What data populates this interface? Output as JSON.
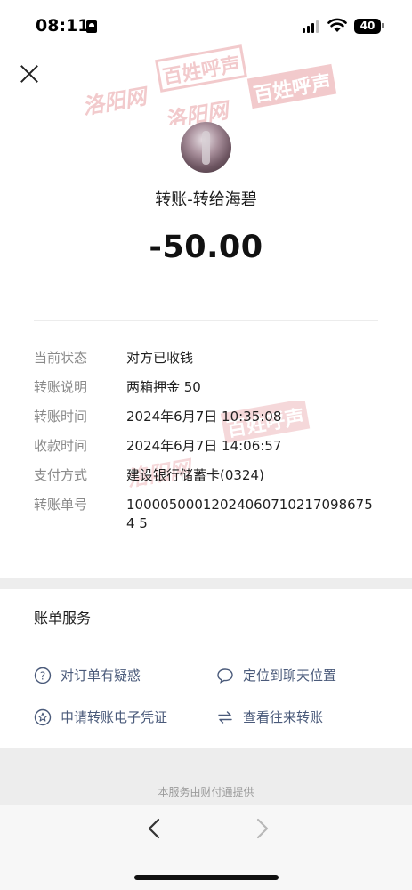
{
  "status_bar": {
    "time": "08:11",
    "battery": "40"
  },
  "header": {
    "title": "转账-转给海碧",
    "amount": "-50.00"
  },
  "details": [
    {
      "label": "当前状态",
      "value": "对方已收钱"
    },
    {
      "label": "转账说明",
      "value": "两箱押金 50"
    },
    {
      "label": "转账时间",
      "value": "2024年6月7日 10:35:08"
    },
    {
      "label": "收款时间",
      "value": "2024年6月7日 14:06:57"
    },
    {
      "label": "支付方式",
      "value": "建设银行储蓄卡(0324)"
    },
    {
      "label": "转账单号",
      "value": "100005000120240607102170986754 5"
    }
  ],
  "services": {
    "title": "账单服务",
    "items": [
      {
        "label": "对订单有疑惑",
        "icon": "question-circle-icon"
      },
      {
        "label": "定位到聊天位置",
        "icon": "chat-bubble-icon"
      },
      {
        "label": "申请转账电子凭证",
        "icon": "star-badge-icon"
      },
      {
        "label": "查看往来转账",
        "icon": "swap-arrows-icon"
      }
    ]
  },
  "footer": {
    "note": "本服务由财付通提供"
  },
  "watermark": {
    "site": "洛阳网",
    "brand": "百姓呼声",
    "color": "#e8a0a4"
  }
}
